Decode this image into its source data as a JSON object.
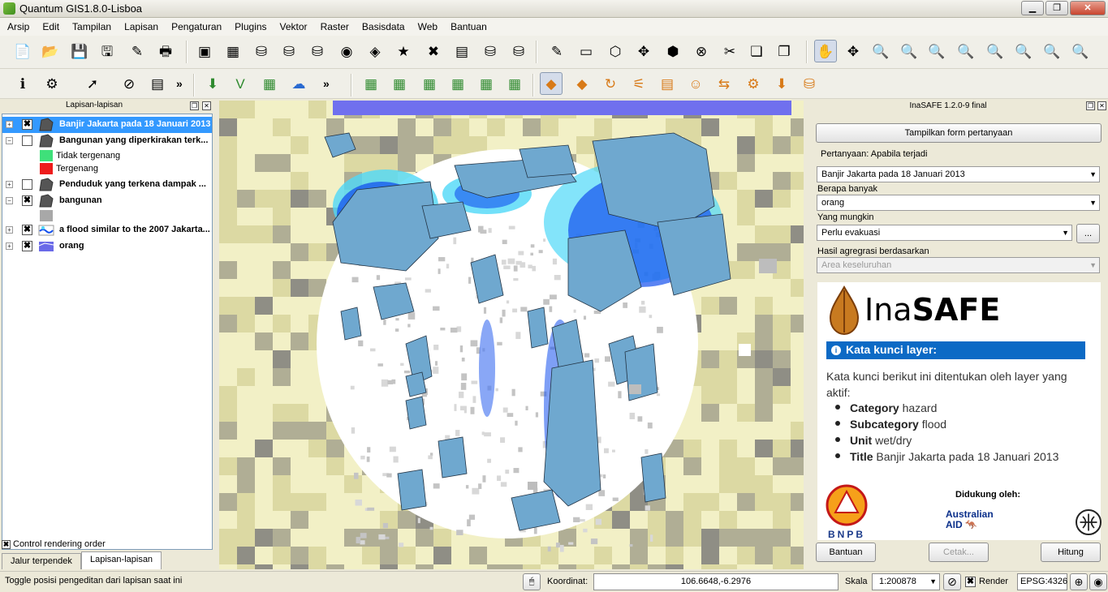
{
  "window": {
    "title": "Quantum GIS1.8.0-Lisboa"
  },
  "menu": [
    "Arsip",
    "Edit",
    "Tampilan",
    "Lapisan",
    "Pengaturan",
    "Plugins",
    "Vektor",
    "Raster",
    "Basisdata",
    "Web",
    "Bantuan"
  ],
  "toolbar1_icons": [
    "new-project-icon",
    "open-project-icon",
    "save-project-icon",
    "save-as-icon",
    "new-print-composer-icon",
    "print-icon",
    "add-vector-layer-icon",
    "add-raster-layer-icon",
    "add-postgis-layer-icon",
    "add-spatialite-layer-icon",
    "add-mssql-layer-icon",
    "add-wms-layer-icon",
    "add-wcs-layer-icon",
    "new-layer-icon",
    "remove-layer-icon",
    "add-delimited-text-icon",
    "add-oracle-layer-icon",
    "add-sql-layer-icon",
    "toggle-editing-icon",
    "save-edits-icon",
    "add-feature-icon",
    "move-feature-icon",
    "node-tool-icon",
    "delete-selected-icon",
    "cut-features-icon",
    "copy-features-icon",
    "paste-features-icon",
    "pan-icon",
    "pan-to-selection-icon",
    "zoom-in-icon",
    "zoom-out-icon",
    "zoom-actual-icon",
    "zoom-full-icon",
    "zoom-to-selection-icon",
    "zoom-to-layer-icon",
    "zoom-last-icon",
    "zoom-next-icon"
  ],
  "toolbar2_icons": [
    "identify-icon",
    "gear-icon",
    "select-icon",
    "deselect-icon",
    "attribute-table-icon",
    "georeferencer-icon",
    "vd-icon",
    "map-image-icon",
    "elephant-icon",
    "plugin-a-icon",
    "plugin-info-icon",
    "plugin-b-icon",
    "plugin-c-icon",
    "plugin-d-icon",
    "plugin-e-icon",
    "inasafe-dock-icon",
    "inasafe-keywords-icon",
    "inasafe-refresh-icon",
    "inasafe-options-icon",
    "inasafe-impact-icon",
    "inasafe-people-icon",
    "inasafe-convert-icon",
    "inasafe-batch-icon",
    "inasafe-download-icon",
    "inasafe-save-icon"
  ],
  "layers_panel": {
    "title": "Lapisan-lapisan",
    "layers": [
      {
        "name": "Banjir Jakarta pada 18 Januari 2013",
        "checked": "✖",
        "selected": true
      },
      {
        "name": "Bangunan yang diperkirakan terk...",
        "checked": "",
        "legend": [
          {
            "label": "Tidak tergenang",
            "color": "#3fe07a"
          },
          {
            "label": "Tergenang",
            "color": "#ee1b1b"
          }
        ]
      },
      {
        "name": "Penduduk yang terkena dampak ...",
        "checked": ""
      },
      {
        "name": "bangunan",
        "checked": "✖"
      },
      {
        "name": "a flood similar to the 2007 Jakarta...",
        "checked": "✖"
      },
      {
        "name": "orang",
        "checked": "✖"
      }
    ],
    "control_rendering": "Control rendering order",
    "tabs": [
      "Jalur terpendek",
      "Lapisan-lapisan"
    ]
  },
  "inasafe": {
    "title": "InaSAFE 1.2.0-9 final",
    "show_question_button": "Tampilkan form pertanyaan",
    "group_label": "Pertanyaan: Apabila terjadi",
    "hazard_value": "Banjir Jakarta pada 18 Januari 2013",
    "how_many_label": "Berapa banyak",
    "exposure_value": "orang",
    "might_label": "Yang mungkin",
    "function_value": "Perlu evakuasi",
    "more_button": "...",
    "aggregation_label": "Hasil agregrasi berdasarkan",
    "aggregation_value": "Area keseluruhan",
    "logo_ina": "Ina",
    "logo_safe": "SAFE",
    "keywords_header": "Kata kunci layer:",
    "keywords_intro": "Kata kunci berikut ini ditentukan oleh layer yang aktif:",
    "keywords": [
      {
        "key": "Category",
        "value": "hazard"
      },
      {
        "key": "Subcategory",
        "value": "flood"
      },
      {
        "key": "Unit",
        "value": "wet/dry"
      },
      {
        "key": "Title",
        "value": "Banjir Jakarta pada 18 Januari 2013"
      }
    ],
    "bnpb_text": "BNPB",
    "supported_by": "Didukung oleh:",
    "ausaid_line1": "Australian",
    "ausaid_line2": "AID",
    "help_button": "Bantuan",
    "print_button": "Cetak...",
    "run_button": "Hitung"
  },
  "status": {
    "message": "Toggle posisi pengeditan dari lapisan saat ini",
    "coordinate_label": "Koordinat:",
    "coordinate_value": "106.6648,-6.2976",
    "scale_label": "Skala",
    "scale_value": "1:200878",
    "render_label": "Render",
    "render_checked": "✖",
    "epsg": "EPSG:4326"
  },
  "colors": {
    "hazard_water": "#7070ee",
    "flood_blue": "#1450ee",
    "flood_light": "#4fd8f8",
    "building_fill": "#6fa8cf",
    "pop_light": "#f2f0c6",
    "pop_mid": "#dcd9a3",
    "pop_dark": "#b0ae95",
    "pop_grey": "#8f8e85"
  }
}
